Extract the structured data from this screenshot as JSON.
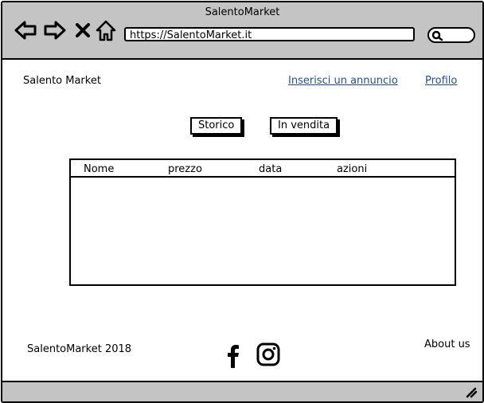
{
  "window": {
    "title": "SalentoMarket"
  },
  "browser": {
    "url": "https://SalentoMarket.it",
    "nav_icons": [
      "back-arrow-icon",
      "forward-arrow-icon",
      "close-icon",
      "home-icon"
    ],
    "search_icon": "search-icon"
  },
  "header": {
    "brand": "Salento Market",
    "links": {
      "post_ad": "Inserisci un annuncio",
      "profile": "Profilo"
    }
  },
  "tabs": {
    "history": "Storico",
    "for_sale": "In vendita"
  },
  "table": {
    "columns": [
      "Nome",
      "prezzo",
      "data",
      "azioni"
    ],
    "rows": []
  },
  "footer": {
    "copyright": "SalentoMarket 2018",
    "about": "About us",
    "social_icons": [
      "facebook-icon",
      "instagram-icon"
    ]
  },
  "colors": {
    "chrome": "#c4c4c4",
    "link": "#1f4f9c"
  }
}
